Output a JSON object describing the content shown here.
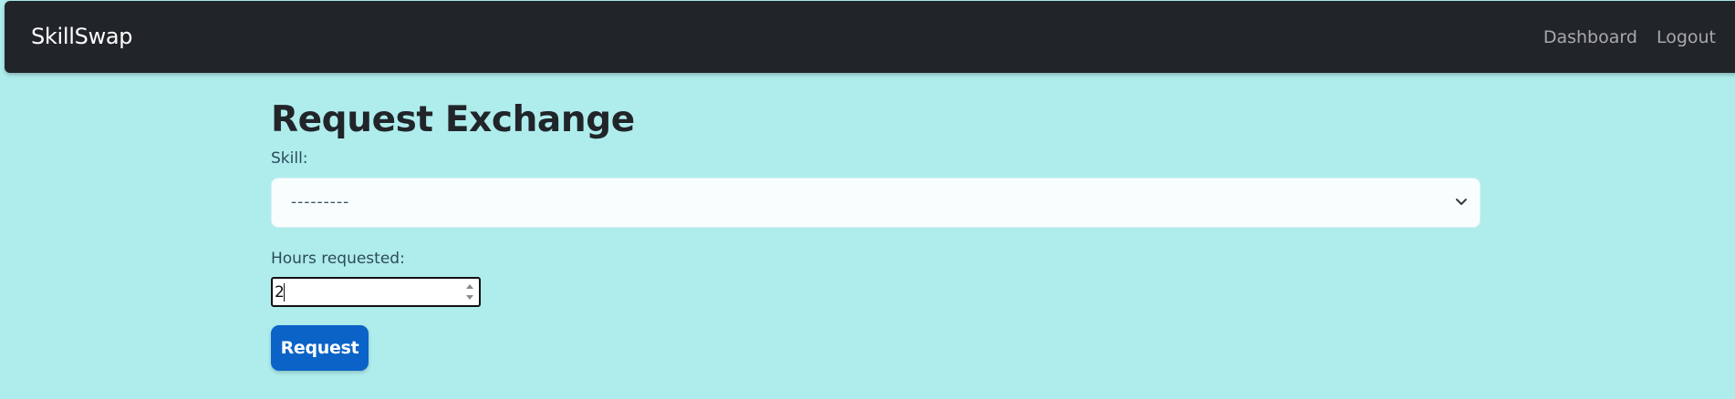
{
  "navbar": {
    "brand": "SkillSwap",
    "links": [
      {
        "label": "Dashboard"
      },
      {
        "label": "Logout"
      }
    ]
  },
  "page": {
    "title": "Request Exchange"
  },
  "form": {
    "skill_label": "Skill:",
    "skill_selected": "---------",
    "hours_label": "Hours requested:",
    "hours_value": "2",
    "submit_label": "Request"
  },
  "colors": {
    "navbar_bg": "#212529",
    "page_bg": "#afeded",
    "button_bg": "#0b63c7"
  },
  "icons": {
    "select": "chevron-down-icon",
    "spinner": "spinner-arrows-icon"
  }
}
